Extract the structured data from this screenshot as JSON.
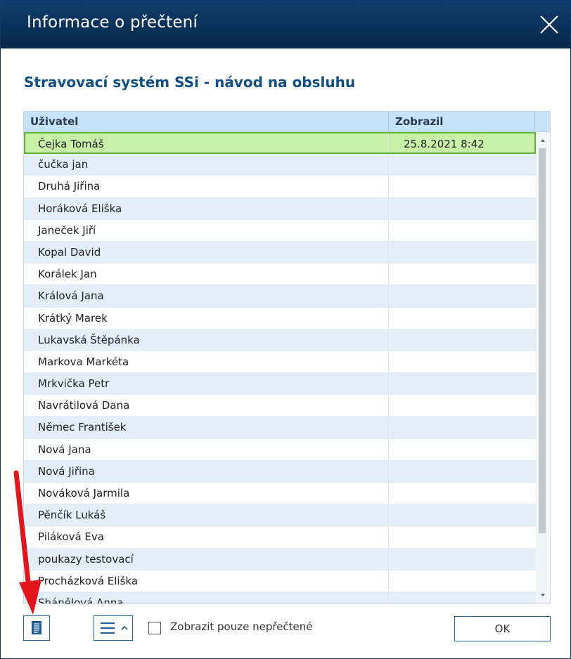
{
  "window": {
    "title": "Informace o přečtení"
  },
  "document": {
    "title": "Stravovací systém SSi - návod na obsluhu"
  },
  "table": {
    "columns": [
      "Uživatel",
      "Zobrazil"
    ],
    "rows": [
      {
        "user": "Čejka Tomáš",
        "shown": "25.8.2021 8:42",
        "selected": true
      },
      {
        "user": "čučka jan",
        "shown": ""
      },
      {
        "user": "Druhá Jiřina",
        "shown": ""
      },
      {
        "user": "Horáková Eliška",
        "shown": ""
      },
      {
        "user": "Janeček Jiří",
        "shown": ""
      },
      {
        "user": "Kopal David",
        "shown": ""
      },
      {
        "user": "Korálek Jan",
        "shown": ""
      },
      {
        "user": "Králová Jana",
        "shown": ""
      },
      {
        "user": "Krátký Marek",
        "shown": ""
      },
      {
        "user": "Lukavská Štěpánka",
        "shown": ""
      },
      {
        "user": "Markova Markéta",
        "shown": ""
      },
      {
        "user": "Mrkvička Petr",
        "shown": ""
      },
      {
        "user": "Navrátilová Dana",
        "shown": ""
      },
      {
        "user": "Němec František",
        "shown": ""
      },
      {
        "user": "Nová Jana",
        "shown": ""
      },
      {
        "user": "Nová Jiřina",
        "shown": ""
      },
      {
        "user": "Nováková Jarmila",
        "shown": ""
      },
      {
        "user": "Pěnčík Lukáš",
        "shown": ""
      },
      {
        "user": "Piláková Eva",
        "shown": ""
      },
      {
        "user": "poukazy testovací",
        "shown": ""
      },
      {
        "user": "Procházková Eliška",
        "shown": ""
      },
      {
        "user": "Sháněl​ová Anna",
        "shown": ""
      }
    ]
  },
  "footer": {
    "checkbox_label": "Zobrazit pouze nepřečtené",
    "checkbox_checked": false,
    "ok_label": "OK"
  },
  "colors": {
    "titlebar": "#0b3460",
    "accent": "#0f4f86",
    "header_row": "#c5e2f6",
    "selected_row": "#c7efa8",
    "annotation_arrow": "#e3141b"
  },
  "icons": {
    "close": "close-icon",
    "document": "document-icon",
    "menu": "hamburger-menu-icon",
    "chevron": "chevron-up-icon"
  }
}
